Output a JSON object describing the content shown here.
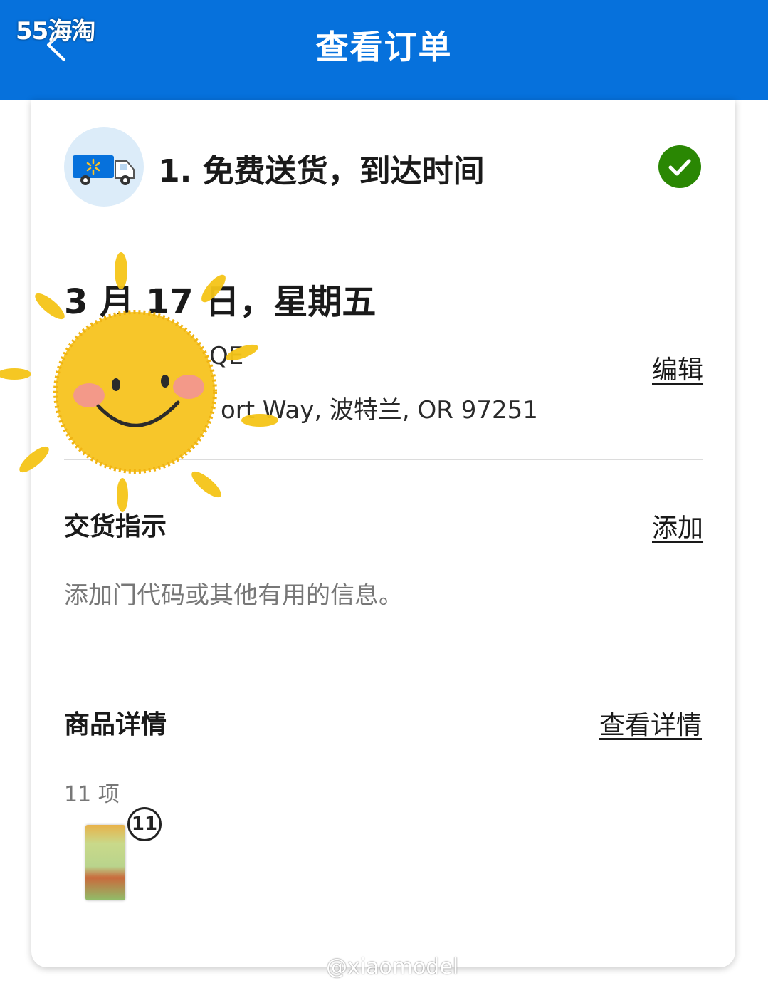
{
  "header": {
    "title": "查看订单",
    "watermark": "55海淘",
    "back_icon": "chevron-left-icon",
    "background_color": "#0671dc"
  },
  "step": {
    "title": "1. 免费送货，到达时间",
    "icon": "delivery-truck-icon",
    "status_icon": "checkmark-circle-icon",
    "status_color": "#2a8703"
  },
  "delivery": {
    "date": "3 月 17 日，星期五",
    "name_partial": "QE",
    "address_partial": "ort Way, 波特兰, OR 97251",
    "edit_label": "编辑"
  },
  "instructions": {
    "title": "交货指示",
    "add_label": "添加",
    "hint": "添加门代码或其他有用的信息。"
  },
  "items": {
    "title": "商品详情",
    "view_label": "查看详情",
    "count": "11 项",
    "quantity_badge": "11"
  },
  "footer": {
    "watermark": "@xiaomodel"
  },
  "sticker": "smiling-sun-sticker"
}
